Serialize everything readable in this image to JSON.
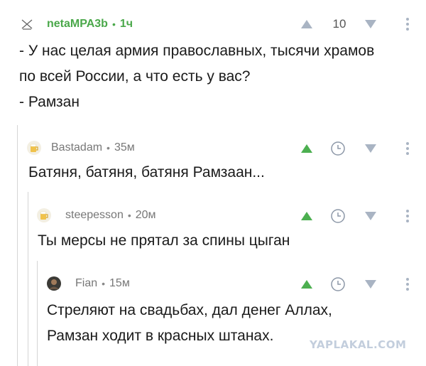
{
  "comments": [
    {
      "username": "netaMPA3b",
      "separator": "•",
      "time": "1ч",
      "rating": "10",
      "text": "- У нас целая армия православных, тысячи храмов\nпо всей России, а что есть у вас?\n- Рамзан",
      "username_color": "#4aa84a",
      "avatar_icon": "x-mark-icon"
    },
    {
      "username": "Bastadam",
      "separator": "•",
      "time": "35м",
      "text": "Батяня, батяня, батяня Рамзаан...",
      "username_color": "#777777",
      "avatar_icon": "beer-avatar-icon"
    },
    {
      "username": "steepesson",
      "separator": "•",
      "time": "20м",
      "text": "Ты мерсы не прятал за спины цыган",
      "username_color": "#777777",
      "avatar_icon": "beer-avatar-icon"
    },
    {
      "username": "Fian",
      "separator": "•",
      "time": "15м",
      "text": "Стреляют на свадьбах, дал денег Аллах,\nРамзан ходит в красных штанах.",
      "username_color": "#777777",
      "avatar_icon": "photo-avatar-icon"
    }
  ],
  "watermark": "YAPLAKAL.COM",
  "colors": {
    "upvote_active": "#4caf50",
    "vote_inactive": "#a9b4c3",
    "thread_line": "#d5d5d5"
  }
}
